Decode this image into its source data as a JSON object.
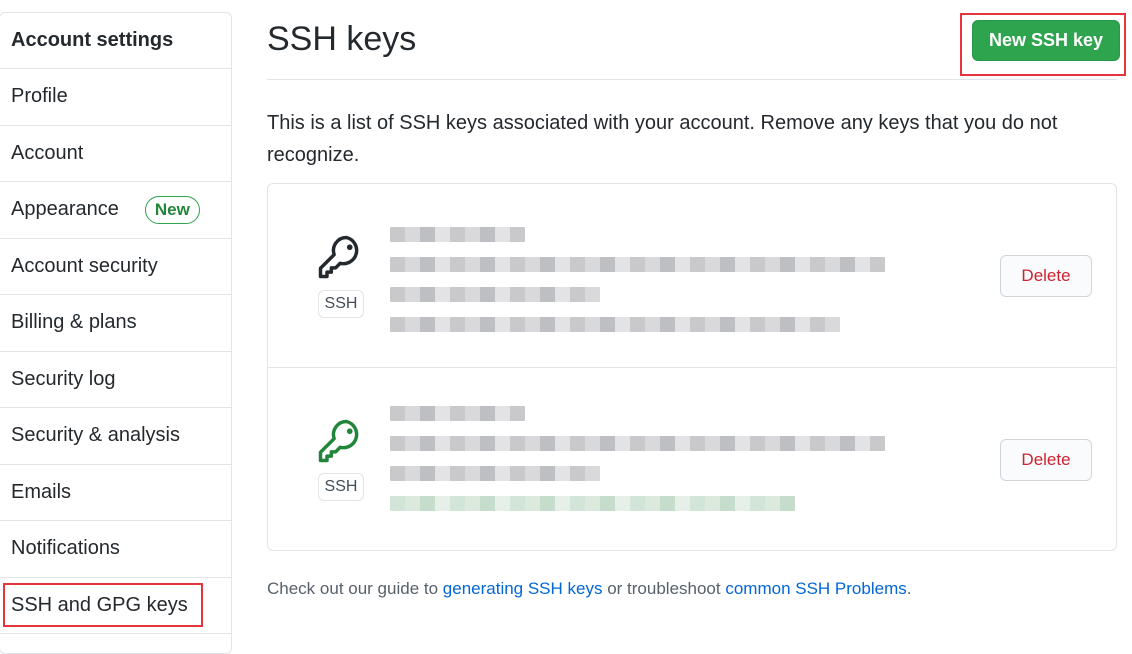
{
  "sidebar": {
    "heading": "Account settings",
    "items": [
      {
        "label": "Profile"
      },
      {
        "label": "Account"
      },
      {
        "label": "Appearance",
        "badge": "New"
      },
      {
        "label": "Account security"
      },
      {
        "label": "Billing & plans"
      },
      {
        "label": "Security log"
      },
      {
        "label": "Security & analysis"
      },
      {
        "label": "Emails"
      },
      {
        "label": "Notifications"
      },
      {
        "label": "SSH and GPG keys",
        "selected": true
      }
    ]
  },
  "header": {
    "title": "SSH keys",
    "new_key_button": "New SSH key"
  },
  "description": "This is a list of SSH keys associated with your account. Remove any keys that you do not recognize.",
  "keys": [
    {
      "type_badge": "SSH",
      "icon": "key-icon",
      "icon_color": "#24292e",
      "details": "redacted",
      "delete_label": "Delete"
    },
    {
      "type_badge": "SSH",
      "icon": "key-icon",
      "icon_color": "#22863a",
      "details": "redacted",
      "delete_label": "Delete"
    }
  ],
  "footer": {
    "prefix": "Check out our guide to ",
    "link1": "generating SSH keys",
    "middle": " or troubleshoot ",
    "link2": "common SSH Problems",
    "suffix": "."
  },
  "colors": {
    "primary_button": "#2ea44f",
    "danger_text": "#cb2431",
    "link": "#0366d6",
    "highlight_box": "#e5343b"
  }
}
